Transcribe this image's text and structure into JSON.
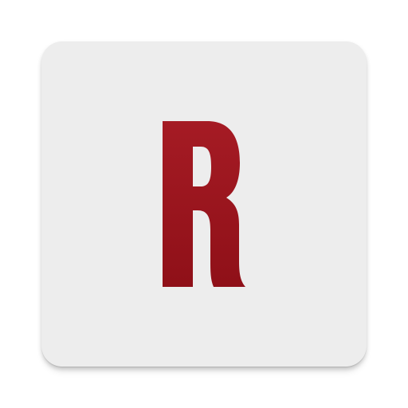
{
  "app_icon": {
    "letter": "R",
    "tile_color": "#EDEDED",
    "letter_color_top": "#A51B24",
    "letter_color_bottom": "#8F1018"
  }
}
